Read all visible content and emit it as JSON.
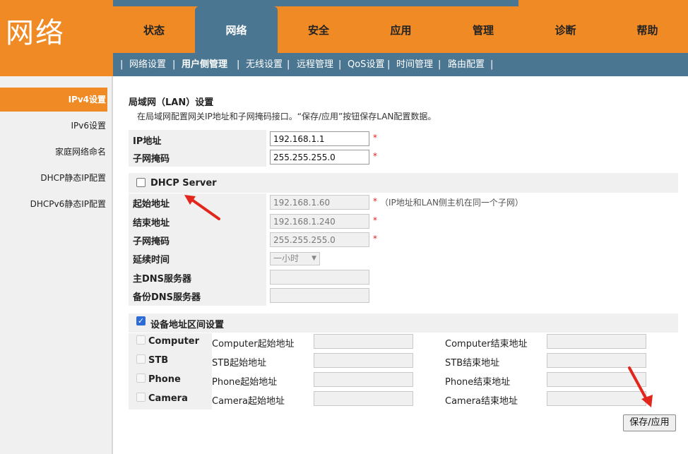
{
  "app": {
    "logo": "网络"
  },
  "main_nav": [
    {
      "label": "状态",
      "active": false
    },
    {
      "label": "网络",
      "active": true
    },
    {
      "label": "安全",
      "active": false
    },
    {
      "label": "应用",
      "active": false
    },
    {
      "label": "管理",
      "active": false
    },
    {
      "label": "诊断",
      "active": false
    },
    {
      "label": "帮助",
      "active": false
    }
  ],
  "sub_nav": {
    "separator": "|",
    "items": [
      {
        "label": "网络设置",
        "active": false
      },
      {
        "label": "用户侧管理",
        "active": true
      },
      {
        "label": "无线设置",
        "active": false
      },
      {
        "label": "远程管理",
        "active": false
      },
      {
        "label": "QoS设置",
        "active": false
      },
      {
        "label": "时间管理",
        "active": false
      },
      {
        "label": "路由配置",
        "active": false
      }
    ]
  },
  "sidebar": {
    "items": [
      {
        "label": "IPv4设置",
        "active": true
      },
      {
        "label": "IPv6设置",
        "active": false
      },
      {
        "label": "家庭网络命名",
        "active": false
      },
      {
        "label": "DHCP静态IP配置",
        "active": false
      },
      {
        "label": "DHCPv6静态IP配置",
        "active": false
      }
    ]
  },
  "lan": {
    "title": "局域网（LAN）设置",
    "description": "在局域网配置网关IP地址和子网掩码接口。“保存/应用”按钮保存LAN配置数据。",
    "required_mark": "*",
    "ip_label": "IP地址",
    "ip_value": "192.168.1.1",
    "mask_label": "子网掩码",
    "mask_value": "255.255.255.0"
  },
  "dhcp": {
    "label": "DHCP Server",
    "checked": false,
    "start_label": "起始地址",
    "start_value": "192.168.1.60",
    "start_hint": "（IP地址和LAN侧主机在同一个子网）",
    "end_label": "结束地址",
    "end_value": "192.168.1.240",
    "mask_label": "子网掩码",
    "mask_value": "255.255.255.0",
    "lease_label": "延续时间",
    "lease_value": "一小时",
    "dns1_label": "主DNS服务器",
    "dns1_value": "",
    "dns2_label": "备份DNS服务器",
    "dns2_value": ""
  },
  "range": {
    "label": "设备地址区间设置",
    "checked": true,
    "rows": [
      {
        "name": "Computer",
        "start_label": "Computer起始地址",
        "end_label": "Computer结束地址",
        "start_value": "",
        "end_value": ""
      },
      {
        "name": "STB",
        "start_label": "STB起始地址",
        "end_label": "STB结束地址",
        "start_value": "",
        "end_value": ""
      },
      {
        "name": "Phone",
        "start_label": "Phone起始地址",
        "end_label": "Phone结束地址",
        "start_value": "",
        "end_value": ""
      },
      {
        "name": "Camera",
        "start_label": "Camera起始地址",
        "end_label": "Camera结束地址",
        "start_value": "",
        "end_value": ""
      }
    ]
  },
  "actions": {
    "save_label": "保存/应用"
  },
  "colors": {
    "orange": "#ef8a24",
    "blue": "#4a7691",
    "arrow_red": "#e3261c"
  }
}
